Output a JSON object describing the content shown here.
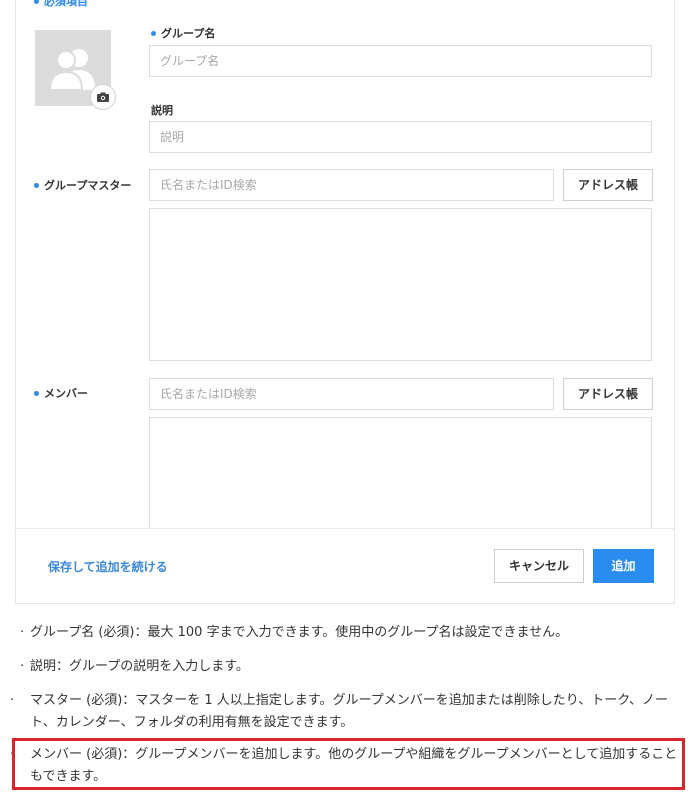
{
  "form": {
    "required_note": "必須項目",
    "group_name_label": "グループ名",
    "group_name_placeholder": "グループ名",
    "description_label": "説明",
    "description_placeholder": "説明",
    "master_label": "グループマスター",
    "master_search_placeholder": "氏名またはID検索",
    "master_address_book": "アドレス帳",
    "member_label": "メンバー",
    "member_search_placeholder": "氏名またはID検索",
    "member_address_book": "アドレス帳"
  },
  "footer": {
    "save_continue": "保存して追加を続ける",
    "cancel": "キャンセル",
    "add": "追加"
  },
  "notes": [
    "グループ名 (必須)：最大 100 字まで入力できます。使用中のグループ名は設定できません。",
    "説明：グループの説明を入力します。",
    "マスター (必須)：マスターを 1 人以上指定します。グループメンバーを追加または削除したり、トーク、ノート、カレンダー、フォルダの利用有無を設定できます。",
    "メンバー (必須)：グループメンバーを追加します。他のグループや組織をグループメンバーとして追加することもできます。"
  ],
  "icons": {
    "avatar": "group-avatar-icon",
    "camera": "camera-icon"
  },
  "colors": {
    "accent": "#2a8cf0",
    "highlight": "#d9232d"
  }
}
